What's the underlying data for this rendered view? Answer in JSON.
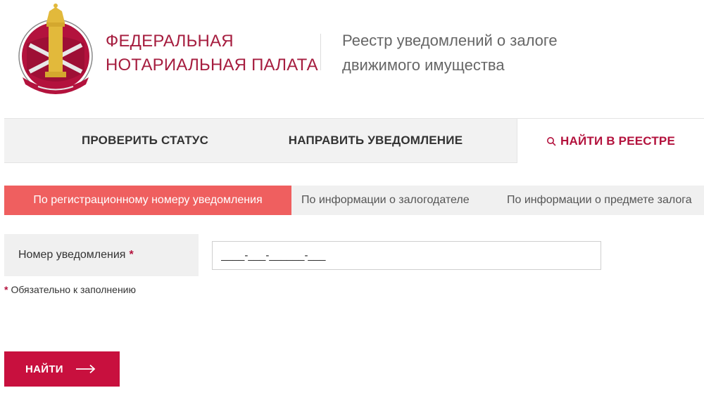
{
  "header": {
    "org_name_line1": "ФЕДЕРАЛЬНАЯ",
    "org_name_line2": "НОТАРИАЛЬНАЯ ПАЛАТА",
    "registry_title_line1": "Реестр уведомлений о залоге",
    "registry_title_line2": "движимого имущества",
    "logo_icon": "notary-chamber-emblem-icon"
  },
  "main_tabs": [
    {
      "label": "ПРОВЕРИТЬ СТАТУС",
      "active": false
    },
    {
      "label": "НАПРАВИТЬ УВЕДОМЛЕНИЕ",
      "active": false
    },
    {
      "label": "НАЙТИ В РЕЕСТРЕ",
      "active": true,
      "icon": "search-icon"
    }
  ],
  "sub_tabs": [
    {
      "label": "По регистрационному номеру уведомления",
      "active": true
    },
    {
      "label": "По информации о залогодателе",
      "active": false
    },
    {
      "label": "По информации о предмете залога",
      "active": false
    }
  ],
  "form": {
    "field_label": "Номер уведомления",
    "required_mark": "*",
    "field_value": "____-___-______-___",
    "required_note": "Обязательно к заполнению"
  },
  "button": {
    "label": "НАЙТИ",
    "icon": "arrow-right-icon"
  },
  "colors": {
    "brand": "#b3123d",
    "button": "#c8103e",
    "active_subtab": "#ef5f5f",
    "tab_bg": "#f2f2f2"
  }
}
